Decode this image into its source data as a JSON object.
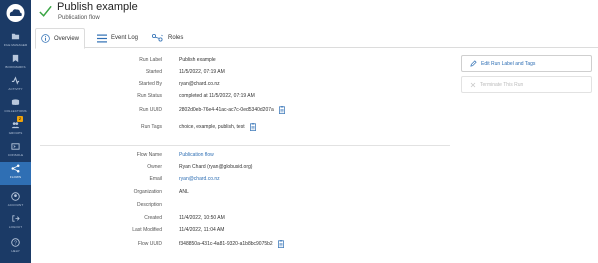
{
  "sidebar": {
    "items": [
      {
        "label": "FILE MANAGER",
        "icon": "folder-icon"
      },
      {
        "label": "BOOKMARKS",
        "icon": "bookmark-icon"
      },
      {
        "label": "ACTIVITY",
        "icon": "activity-icon"
      },
      {
        "label": "COLLECTIONS",
        "icon": "collections-icon"
      },
      {
        "label": "GROUPS",
        "icon": "groups-icon",
        "badge": "2"
      },
      {
        "label": "CONSOLE",
        "icon": "console-icon"
      },
      {
        "label": "FLOWS",
        "icon": "flows-icon",
        "active": true
      },
      {
        "label": "ACCOUNT",
        "icon": "account-icon"
      },
      {
        "label": "LOGOUT",
        "icon": "logout-icon"
      },
      {
        "label": "HELP",
        "icon": "help-icon"
      }
    ]
  },
  "header": {
    "title": "Publish example",
    "subtitle": "Publication flow"
  },
  "tabs": [
    {
      "label": "Overview",
      "icon": "info-icon",
      "active": true
    },
    {
      "label": "Event Log",
      "icon": "list-icon"
    },
    {
      "label": "Roles",
      "icon": "roles-icon"
    }
  ],
  "run": {
    "label_key": "Run Label",
    "label": "Publish example",
    "started_key": "Started",
    "started": "11/5/2022, 07:19 AM",
    "started_by_key": "Started By",
    "started_by": "ryan@chard.co.nz",
    "status_key": "Run Status",
    "status": "completed at 11/5/2022, 07:19 AM",
    "uuid_key": "Run UUID",
    "uuid": "2802d0eb-76e4-41ac-ac7c-0ed5340d207a",
    "tags_key": "Run Tags",
    "tags": "choice, example, publish, test"
  },
  "flow": {
    "name_key": "Flow Name",
    "name": "Publication flow",
    "owner_key": "Owner",
    "owner": "Ryan Chard (ryan@globusid.org)",
    "email_key": "Email",
    "email": "ryan@chard.co.nz",
    "org_key": "Organization",
    "org": "ANL",
    "desc_key": "Description",
    "desc": "",
    "created_key": "Created",
    "created": "11/4/2022, 10:50 AM",
    "modified_key": "Last Modified",
    "modified": "11/4/2022, 11:04 AM",
    "uuid_key": "Flow UUID",
    "uuid": "f348850a-431c-4a81-9320-a1b8bc9075b2"
  },
  "actions": {
    "edit_label": "Edit Run Label and Tags",
    "terminate_label": "Terminate This Run"
  },
  "colors": {
    "sidebar": "#1b3a66",
    "accent": "#2f6fb4",
    "success": "#3aa544"
  }
}
